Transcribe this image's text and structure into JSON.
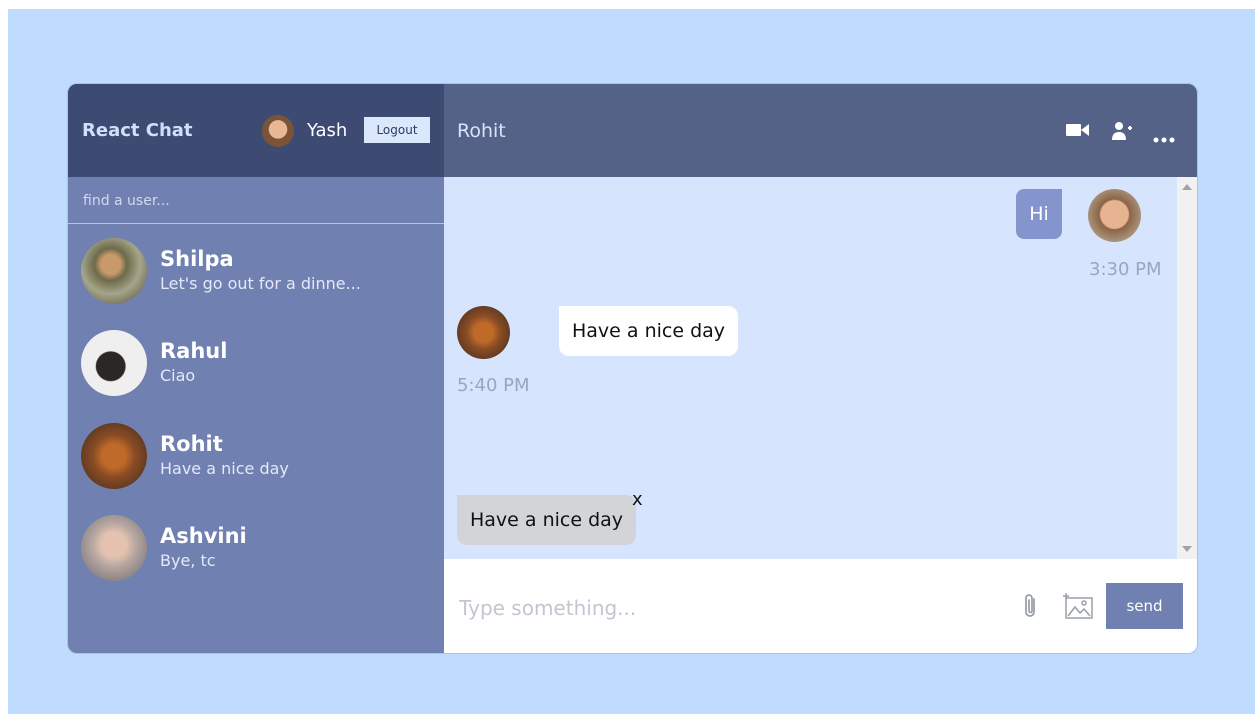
{
  "brand": "React Chat",
  "current_user": {
    "name": "Yash",
    "logout_label": "Logout"
  },
  "search": {
    "placeholder": "find a user...",
    "value": ""
  },
  "chats": [
    {
      "name": "Shilpa",
      "last_message": "Let's go out for a dinne..."
    },
    {
      "name": "Rahul",
      "last_message": "Ciao"
    },
    {
      "name": "Rohit",
      "last_message": "Have a nice day"
    },
    {
      "name": "Ashvini",
      "last_message": "Bye, tc"
    }
  ],
  "conversation": {
    "peer_name": "Rohit",
    "header_icons": [
      "video-camera-icon",
      "add-user-icon",
      "more-options-icon"
    ],
    "messages": [
      {
        "from": "me",
        "text": "Hi",
        "time": "3:30 PM"
      },
      {
        "from": "peer",
        "text": "Have a nice day",
        "time": "5:40 PM"
      }
    ],
    "pending_image_preview": {
      "text": "Have a nice day",
      "remove_label": "x"
    }
  },
  "composer": {
    "placeholder": "Type something...",
    "value": "",
    "attach_icon": "paperclip-icon",
    "image_icon": "add-image-icon",
    "send_label": "send"
  },
  "colors": {
    "page_bg": "#bfdbfe",
    "sidebar_header": "#3d4a72",
    "sidebar": "#7080b1",
    "main_header": "#556287",
    "chat_bg": "#d6e5fd",
    "own_bubble": "#8494cd",
    "send_button": "#7080b1"
  }
}
